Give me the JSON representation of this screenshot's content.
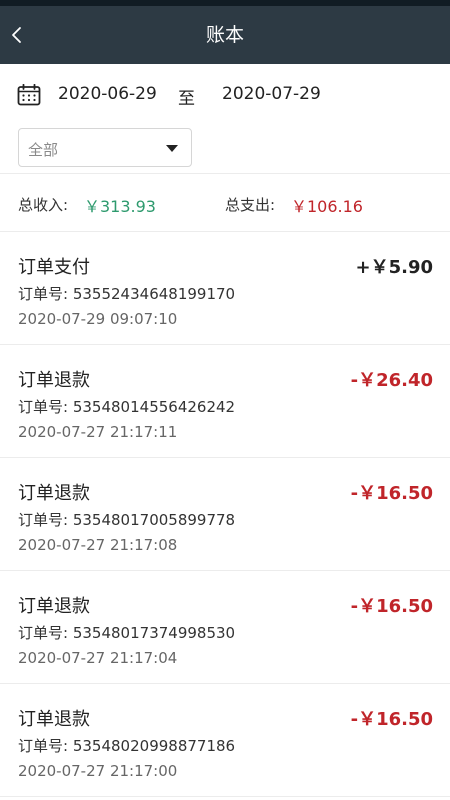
{
  "header": {
    "title": "账本"
  },
  "date_range": {
    "start": "2020-06-29",
    "separator": "至",
    "end": "2020-07-29"
  },
  "filter": {
    "selected": "全部"
  },
  "summary": {
    "income_label": "总收入:",
    "income_value": "￥313.93",
    "expense_label": "总支出:",
    "expense_value": "￥106.16"
  },
  "colors": {
    "nav_bg": "#2d3a44",
    "income": "#2e9a6e",
    "expense": "#c0252a"
  },
  "transactions": [
    {
      "title": "订单支付",
      "amount": "+￥5.90",
      "order_label": "订单号:",
      "order_no": "53552434648199170",
      "time": "2020-07-29 09:07:10",
      "type": "income"
    },
    {
      "title": "订单退款",
      "amount": "-￥26.40",
      "order_label": "订单号:",
      "order_no": "53548014556426242",
      "time": "2020-07-27 21:17:11",
      "type": "expense"
    },
    {
      "title": "订单退款",
      "amount": "-￥16.50",
      "order_label": "订单号:",
      "order_no": "53548017005899778",
      "time": "2020-07-27 21:17:08",
      "type": "expense"
    },
    {
      "title": "订单退款",
      "amount": "-￥16.50",
      "order_label": "订单号:",
      "order_no": "53548017374998530",
      "time": "2020-07-27 21:17:04",
      "type": "expense"
    },
    {
      "title": "订单退款",
      "amount": "-￥16.50",
      "order_label": "订单号:",
      "order_no": "53548020998877186",
      "time": "2020-07-27 21:17:00",
      "type": "expense"
    }
  ]
}
